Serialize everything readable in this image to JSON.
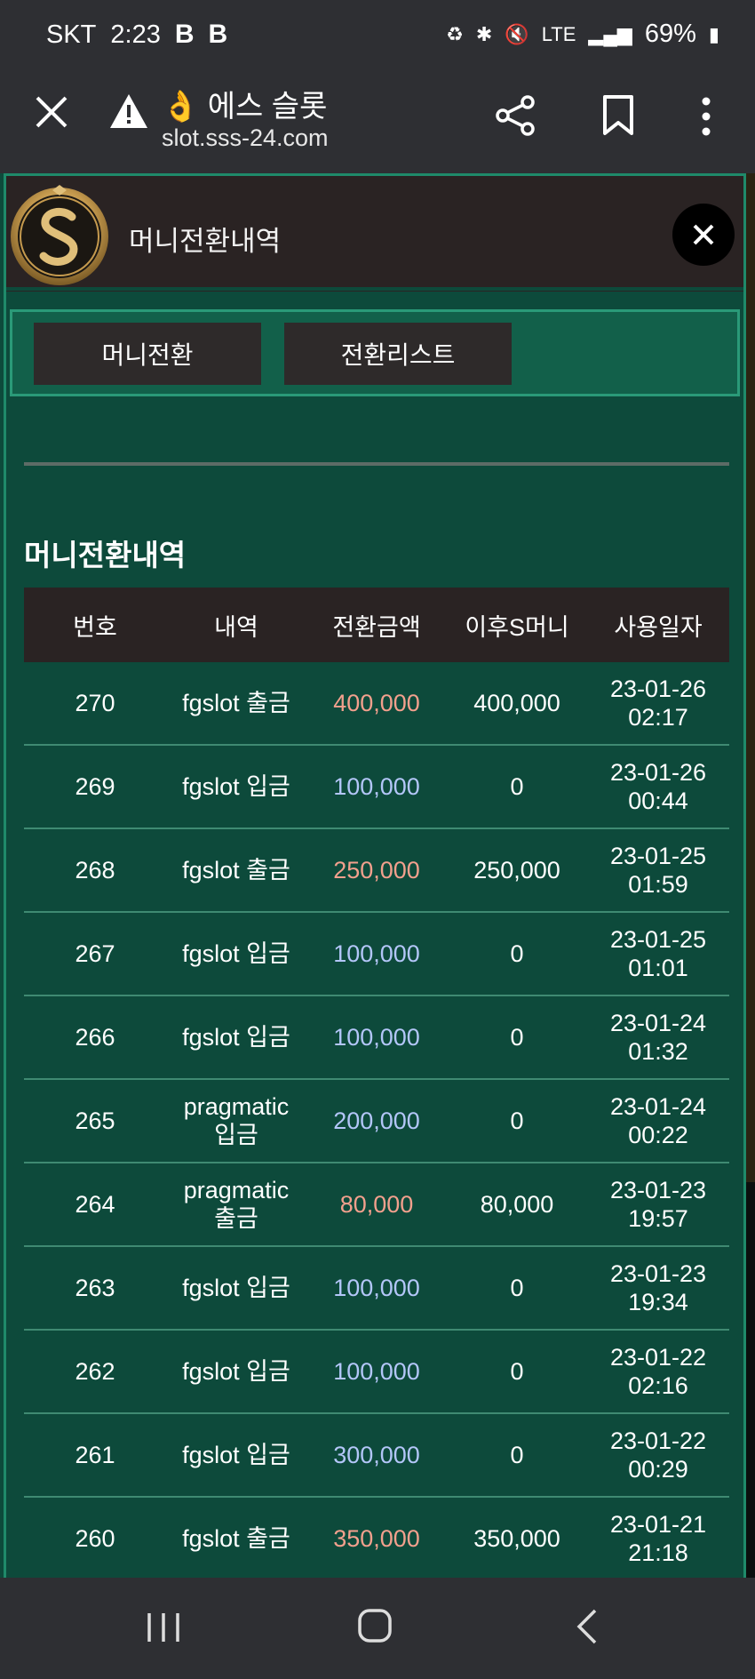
{
  "status_bar": {
    "carrier": "SKT",
    "time": "2:23",
    "app_badges": [
      "B",
      "B"
    ],
    "network": "LTE",
    "battery": "69%"
  },
  "browser": {
    "title": "👌 에스 슬롯",
    "url": "slot.sss-24.com"
  },
  "modal": {
    "title": "머니전환내역",
    "tabs": [
      "머니전환",
      "전환리스트"
    ],
    "section_title": "머니전환내역",
    "columns": [
      "번호",
      "내역",
      "전환금액",
      "이후S머니",
      "사용일자"
    ],
    "rows": [
      {
        "no": "270",
        "desc": "fgslot 출금",
        "amount": "400,000",
        "type": "out",
        "after": "400,000",
        "date": "23-01-26",
        "time": "02:17"
      },
      {
        "no": "269",
        "desc": "fgslot 입금",
        "amount": "100,000",
        "type": "in",
        "after": "0",
        "date": "23-01-26",
        "time": "00:44"
      },
      {
        "no": "268",
        "desc": "fgslot 출금",
        "amount": "250,000",
        "type": "out",
        "after": "250,000",
        "date": "23-01-25",
        "time": "01:59"
      },
      {
        "no": "267",
        "desc": "fgslot 입금",
        "amount": "100,000",
        "type": "in",
        "after": "0",
        "date": "23-01-25",
        "time": "01:01"
      },
      {
        "no": "266",
        "desc": "fgslot 입금",
        "amount": "100,000",
        "type": "in",
        "after": "0",
        "date": "23-01-24",
        "time": "01:32"
      },
      {
        "no": "265",
        "desc": "pragmatic 입금",
        "amount": "200,000",
        "type": "in",
        "after": "0",
        "date": "23-01-24",
        "time": "00:22"
      },
      {
        "no": "264",
        "desc": "pragmatic 출금",
        "amount": "80,000",
        "type": "out",
        "after": "80,000",
        "date": "23-01-23",
        "time": "19:57"
      },
      {
        "no": "263",
        "desc": "fgslot 입금",
        "amount": "100,000",
        "type": "in",
        "after": "0",
        "date": "23-01-23",
        "time": "19:34"
      },
      {
        "no": "262",
        "desc": "fgslot 입금",
        "amount": "100,000",
        "type": "in",
        "after": "0",
        "date": "23-01-22",
        "time": "02:16"
      },
      {
        "no": "261",
        "desc": "fgslot 입금",
        "amount": "300,000",
        "type": "in",
        "after": "0",
        "date": "23-01-22",
        "time": "00:29"
      },
      {
        "no": "260",
        "desc": "fgslot 출금",
        "amount": "350,000",
        "type": "out",
        "after": "350,000",
        "date": "23-01-21",
        "time": "21:18"
      }
    ]
  },
  "colors": {
    "page_bg": "#0d4a3b",
    "header_bg": "#2a2323",
    "withdraw_amount": "#f2a08d",
    "deposit_amount": "#b3c6f8"
  }
}
